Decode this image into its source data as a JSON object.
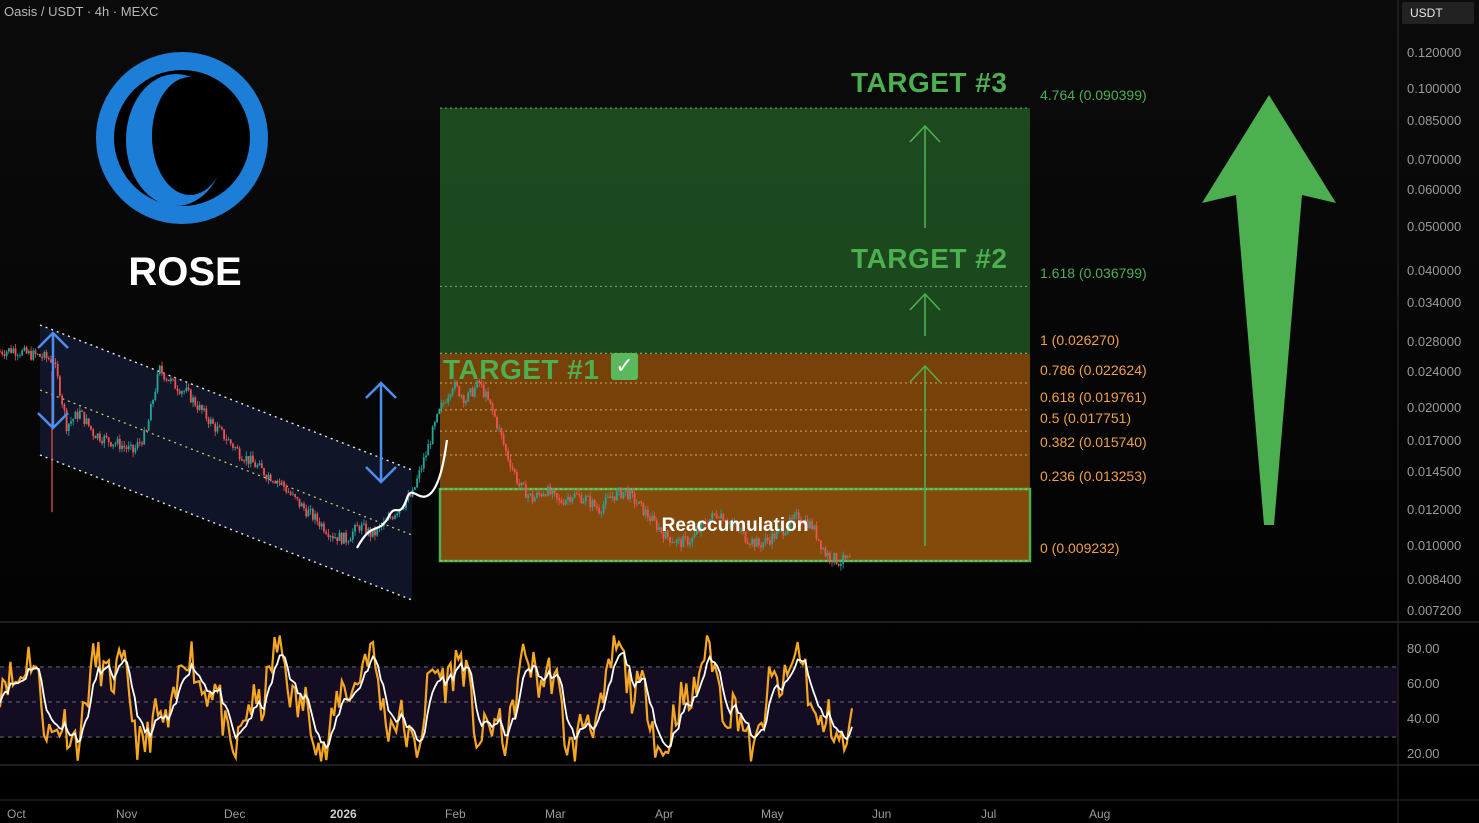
{
  "header": {
    "title": "Oasis / USDT · 4h · MEXC"
  },
  "price_axis": {
    "unit": "USDT",
    "ticks": [
      "0.120000",
      "0.100000",
      "0.085000",
      "0.070000",
      "0.060000",
      "0.050000",
      "0.040000",
      "0.034000",
      "0.028000",
      "0.024000",
      "0.020000",
      "0.017000",
      "0.014500",
      "0.012000",
      "0.010000",
      "0.008400",
      "0.007200"
    ]
  },
  "ticker_label": "ROSE",
  "targets": [
    "TARGET #1",
    "TARGET #2",
    "TARGET #3"
  ],
  "target1_check": "✓",
  "zone_label": "Reaccumulation",
  "fib_levels": [
    {
      "label": "4.764 (0.090399)",
      "price": 0.090399
    },
    {
      "label": "1.618 (0.036799)",
      "price": 0.036799
    },
    {
      "label": "1 (0.026270)",
      "price": 0.02627
    },
    {
      "label": "0.786 (0.022624)",
      "price": 0.022624
    },
    {
      "label": "0.618 (0.019761)",
      "price": 0.019761
    },
    {
      "label": "0.5 (0.017751)",
      "price": 0.017751
    },
    {
      "label": "0.382 (0.015740)",
      "price": 0.01574
    },
    {
      "label": "0.236 (0.013253)",
      "price": 0.013253
    },
    {
      "label": "0 (0.009232)",
      "price": 0.009232
    }
  ],
  "osc_axis": {
    "ticks": [
      "80.00",
      "60.00",
      "40.00",
      "20.00"
    ]
  },
  "time_axis": {
    "ticks": [
      "Oct",
      "Nov",
      "Dec",
      "2026",
      "Feb",
      "Mar",
      "Apr",
      "May",
      "Jun",
      "Jul",
      "Aug"
    ]
  },
  "colors": {
    "green": "#4caf50",
    "orange": "#f0a04b",
    "blue": "#2a7de1",
    "oscillator": "#f5a623",
    "signal": "#ffffff"
  },
  "chart_data": {
    "type": "line",
    "title": "Oasis / USDT · 4h · MEXC",
    "scale": "log",
    "ylim": [
      0.0068,
      0.14
    ],
    "x_ticks": [
      "Oct",
      "Nov",
      "Dec",
      "2026",
      "Feb",
      "Mar",
      "Apr",
      "May",
      "Jun",
      "Jul",
      "Aug"
    ],
    "series": [
      {
        "values": [
          0.0265,
          0.0268,
          0.0262,
          0.0259,
          0.0254,
          0.0183,
          0.0195,
          0.0176,
          0.017,
          0.0166,
          0.016,
          0.0176,
          0.0242,
          0.0225,
          0.0216,
          0.0199,
          0.0183,
          0.0171,
          0.0159,
          0.0151,
          0.0143,
          0.0138,
          0.0127,
          0.0119,
          0.0112,
          0.0105,
          0.0103,
          0.011,
          0.0105,
          0.0112,
          0.0121,
          0.0129,
          0.0158,
          0.0195,
          0.0225,
          0.0208,
          0.0226,
          0.0196,
          0.016,
          0.0135,
          0.0126,
          0.0132,
          0.0124,
          0.0129,
          0.0126,
          0.012,
          0.0128,
          0.0131,
          0.0122,
          0.0113,
          0.0105,
          0.0101,
          0.0103,
          0.0112,
          0.0118,
          0.0111,
          0.0104,
          0.01,
          0.0104,
          0.0109,
          0.0116,
          0.011,
          0.0096,
          0.0092,
          0.0093
        ]
      }
    ],
    "oscillator": {
      "ylim": [
        10,
        90
      ],
      "bands": [
        30,
        50,
        70
      ],
      "ticks": [
        80,
        60,
        40,
        20
      ]
    }
  }
}
